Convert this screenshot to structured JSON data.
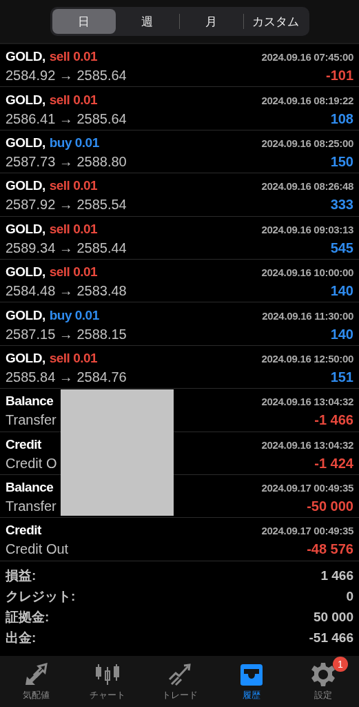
{
  "period_tabs": [
    {
      "label": "日",
      "selected": true
    },
    {
      "label": "週",
      "selected": false
    },
    {
      "label": "月",
      "selected": false
    },
    {
      "label": "カスタム",
      "selected": false
    }
  ],
  "deals": [
    {
      "kind": "trade",
      "symbol": "GOLD,",
      "buy": false,
      "order": "sell 0.01",
      "time": "2024.09.16 07:45:00",
      "detail": "2584.92 → 2585.64",
      "result": "-101",
      "loss": true
    },
    {
      "kind": "trade",
      "symbol": "GOLD,",
      "buy": false,
      "order": "sell 0.01",
      "time": "2024.09.16 08:19:22",
      "detail": "2586.41 → 2585.64",
      "result": "108",
      "loss": false
    },
    {
      "kind": "trade",
      "symbol": "GOLD,",
      "buy": true,
      "order": "buy 0.01",
      "time": "2024.09.16 08:25:00",
      "detail": "2587.73 → 2588.80",
      "result": "150",
      "loss": false
    },
    {
      "kind": "trade",
      "symbol": "GOLD,",
      "buy": false,
      "order": "sell 0.01",
      "time": "2024.09.16 08:26:48",
      "detail": "2587.92 → 2585.54",
      "result": "333",
      "loss": false
    },
    {
      "kind": "trade",
      "symbol": "GOLD,",
      "buy": false,
      "order": "sell 0.01",
      "time": "2024.09.16 09:03:13",
      "detail": "2589.34 → 2585.44",
      "result": "545",
      "loss": false
    },
    {
      "kind": "trade",
      "symbol": "GOLD,",
      "buy": false,
      "order": "sell 0.01",
      "time": "2024.09.16 10:00:00",
      "detail": "2584.48 → 2583.48",
      "result": "140",
      "loss": false
    },
    {
      "kind": "trade",
      "symbol": "GOLD,",
      "buy": true,
      "order": "buy 0.01",
      "time": "2024.09.16 11:30:00",
      "detail": "2587.15 → 2588.15",
      "result": "140",
      "loss": false
    },
    {
      "kind": "trade",
      "symbol": "GOLD,",
      "buy": false,
      "order": "sell 0.01",
      "time": "2024.09.16 12:50:00",
      "detail": "2585.84 → 2584.76",
      "result": "151",
      "loss": false
    },
    {
      "kind": "balance",
      "symbol": "Balance",
      "time": "2024.09.16 13:04:32",
      "detail": "Transfer",
      "result": "-1 466",
      "loss": true
    },
    {
      "kind": "balance",
      "symbol": "Credit",
      "time": "2024.09.16 13:04:32",
      "detail": "Credit O",
      "result": "-1 424",
      "loss": true
    },
    {
      "kind": "balance",
      "symbol": "Balance",
      "time": "2024.09.17 00:49:35",
      "detail": "Transfer",
      "result": "-50 000",
      "loss": true
    },
    {
      "kind": "balance",
      "symbol": "Credit",
      "time": "2024.09.17 00:49:35",
      "detail": "Credit Out",
      "result": "-48 576",
      "loss": true
    }
  ],
  "summary": [
    {
      "label": "損益:",
      "value": "1 466"
    },
    {
      "label": "クレジット:",
      "value": "0"
    },
    {
      "label": "証拠金:",
      "value": "50 000"
    },
    {
      "label": "出金:",
      "value": "-51 466"
    }
  ],
  "tab_bar": [
    {
      "label": "気配値",
      "selected": false
    },
    {
      "label": "チャート",
      "selected": false
    },
    {
      "label": "トレード",
      "selected": false
    },
    {
      "label": "履歴",
      "selected": true
    },
    {
      "label": "設定",
      "selected": false,
      "badge": "1"
    }
  ]
}
